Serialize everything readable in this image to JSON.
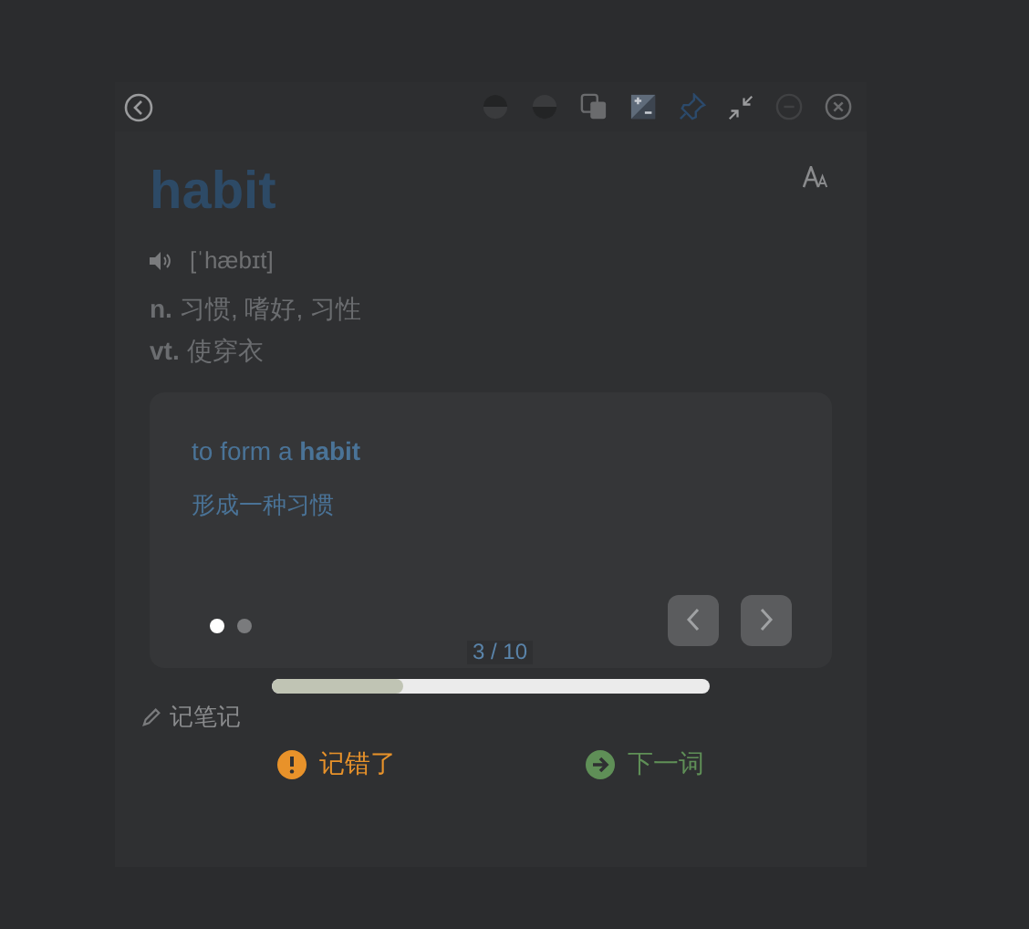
{
  "word": "habit",
  "phonetic": "[ˈhæbɪt]",
  "definitions": [
    {
      "pos": "n.",
      "meaning": "习惯, 嗜好, 习性"
    },
    {
      "pos": "vt.",
      "meaning": "使穿衣"
    }
  ],
  "example": {
    "sentence": "to form a **habit**",
    "translation": "形成一种习惯",
    "dots": [
      {
        "selected": true
      },
      {
        "selected": false
      }
    ]
  },
  "counter": "3 / 10",
  "note_link": "记笔记",
  "progress": {
    "level": 0.3
  },
  "actions": [
    {
      "kind": "wrong",
      "label": "记错了"
    },
    {
      "kind": "next",
      "label": "下一词"
    }
  ]
}
